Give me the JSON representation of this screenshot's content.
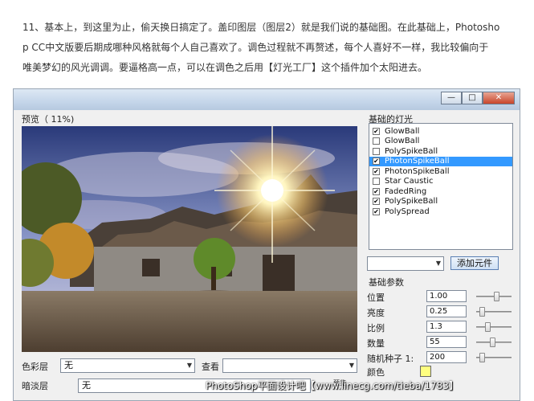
{
  "article": {
    "line1": "11、基本上，到这里为止，偷天换日搞定了。盖印图层（图层2）就是我们说的基础图。在此基础上，Photosho",
    "line2": "p CC中文版要后期成哪种风格就每个人自己喜欢了。调色过程就不再赘述，每个人喜好不一样，我比较偏向于",
    "line3": "唯美梦幻的风光调调。要逼格高一点，可以在调色之后用【灯光工厂】这个插件加个太阳进去。"
  },
  "window": {
    "btn_min": "—",
    "btn_max": "□",
    "btn_close": "✕"
  },
  "preview": {
    "label": "预览（   11%)"
  },
  "bottom_form": {
    "color_layer_label": "色彩层",
    "color_layer_value": "无",
    "view_label": "查看",
    "view_value": "",
    "dark_layer_label": "暗淡层",
    "dark_layer_value": "无",
    "ghost_label": "预览"
  },
  "lights": {
    "label": "基础的灯光",
    "items": [
      {
        "name": "GlowBall",
        "checked": "✔"
      },
      {
        "name": "GlowBall",
        "checked": ""
      },
      {
        "name": "PolySpikeBall",
        "checked": ""
      },
      {
        "name": "PhotonSpikeBall",
        "checked": "✔"
      },
      {
        "name": "PhotonSpikeBall",
        "checked": "✔"
      },
      {
        "name": "Star Caustic",
        "checked": ""
      },
      {
        "name": "FadedRing",
        "checked": "✔"
      },
      {
        "name": "PolySpikeBall",
        "checked": "✔"
      },
      {
        "name": "PolySpread",
        "checked": "✔"
      }
    ],
    "selected_index": 3,
    "element_select_value": "",
    "add_button": "添加元件"
  },
  "params": {
    "label": "基础参数",
    "position_label": "位置",
    "position_value": "1.00",
    "brightness_label": "亮度",
    "brightness_value": "0.25",
    "scale_label": "比例",
    "scale_value": "1.3",
    "count_label": "数量",
    "count_value": "55",
    "seed_label": "随机种子 1:",
    "seed_value": "200",
    "color_label": "颜色",
    "color_hex": "#ffff80",
    "slider_levels": [
      0.6,
      0.1,
      0.3,
      0.45,
      0.1
    ]
  },
  "watermark": "PhotoShop平面设计吧【www.linecg.com/tieba/1783】"
}
